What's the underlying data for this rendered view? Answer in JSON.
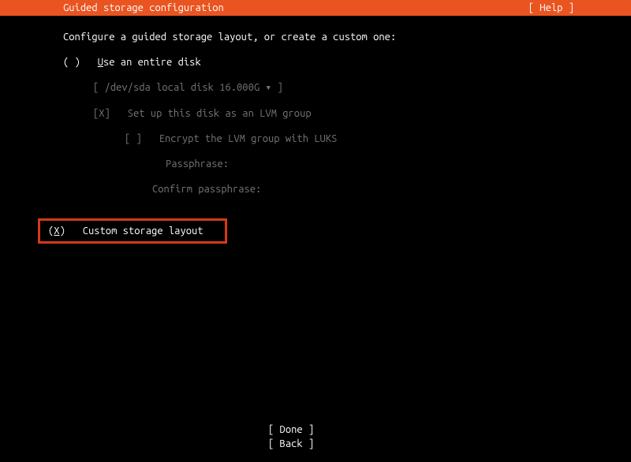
{
  "header": {
    "title": "Guided storage configuration",
    "help": "[ Help ]"
  },
  "instruction": "Configure a guided storage layout, or create a custom one:",
  "option_entire_disk": {
    "marker": "( )",
    "label": "Use an entire disk",
    "accel": "U"
  },
  "disk_select": {
    "open": "[ ",
    "text": "/dev/sda local disk 16.000G",
    "chev": " ▾ ",
    "close": "]"
  },
  "lvm_option": {
    "marker": "[X]",
    "label": "Set up this disk as an LVM group"
  },
  "luks_option": {
    "marker": "[ ]",
    "label": "Encrypt the LVM group with LUKS"
  },
  "passphrase_label": "Passphrase:",
  "confirm_label": "Confirm passphrase:",
  "option_custom": {
    "marker_open": "(",
    "accel": "X",
    "marker_close": ")",
    "label": "Custom storage layout"
  },
  "footer": {
    "done": "[ Done       ]",
    "back": "[ Back       ]"
  }
}
